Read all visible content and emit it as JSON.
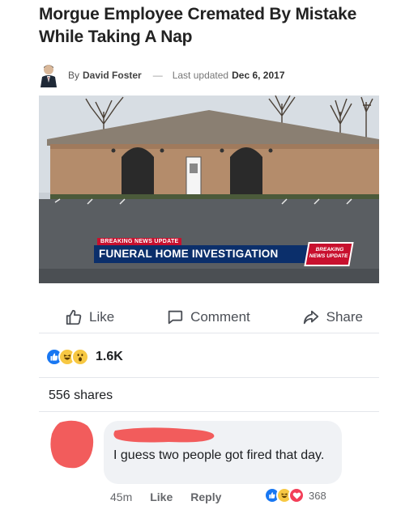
{
  "article": {
    "headline": "Morgue Employee Cremated By Mistake While Taking A Nap",
    "by": "By",
    "author": "David Foster",
    "dash": "—",
    "updated_label": "Last updated",
    "date": "Dec 6, 2017",
    "breaking_tag": "BREAKING NEWS UPDATE",
    "chyron": "FUNERAL HOME INVESTIGATION",
    "chyron_logo": "BREAKING NEWS UPDATE"
  },
  "actions": {
    "like": "Like",
    "comment": "Comment",
    "share": "Share"
  },
  "reactions": {
    "count": "1.6K",
    "icons": [
      "like-icon",
      "haha-icon",
      "wow-icon"
    ]
  },
  "shares": "556 shares",
  "comment": {
    "text": "I guess two people got fired that day.",
    "time": "45m",
    "like": "Like",
    "reply": "Reply",
    "reaction_count": "368",
    "reaction_icons": [
      "like-icon",
      "haha-icon",
      "love-icon"
    ]
  },
  "colors": {
    "facebook_blue": "#1877f2",
    "redaction": "#f25c5c",
    "chyron_navy": "#0b2f6b",
    "breaking_red": "#c8102e"
  }
}
